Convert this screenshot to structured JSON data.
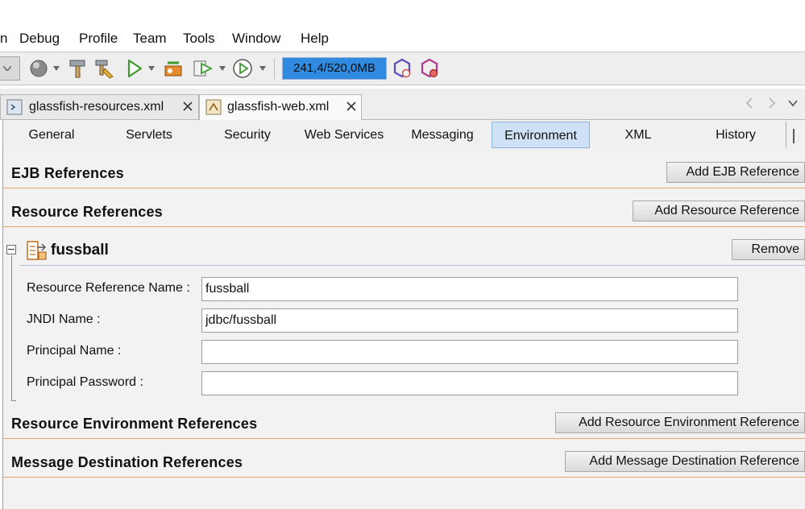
{
  "menu": {
    "items": [
      "n",
      "Debug",
      "Profile",
      "Team",
      "Tools",
      "Window",
      "Help"
    ]
  },
  "toolbar": {
    "memory_label": "241,4/520,0MB",
    "icons": [
      "combo-dropdown",
      "globe-icon",
      "hammer-icon",
      "clean-build-icon",
      "run-icon",
      "debug-icon",
      "profile-icon",
      "performance-icon",
      "gc-icon",
      "memory-reset-icon"
    ]
  },
  "file_tabs": [
    {
      "label": "glassfish-resources.xml",
      "active": false
    },
    {
      "label": "glassfish-web.xml",
      "active": true
    }
  ],
  "editor_tabs": [
    "General",
    "Servlets",
    "Security",
    "Web Services",
    "Messaging",
    "Environment",
    "XML",
    "History"
  ],
  "active_editor_tab": "Environment",
  "sections": {
    "ejb": {
      "title": "EJB References",
      "button": "Add EJB Reference"
    },
    "resource": {
      "title": "Resource References",
      "button": "Add Resource Reference"
    },
    "resource_env": {
      "title": "Resource Environment References",
      "button": "Add Resource Environment Reference"
    },
    "message_dest": {
      "title": "Message Destination References",
      "button": "Add Message Destination Reference"
    }
  },
  "resource_item": {
    "name": "fussball",
    "remove_label": "Remove",
    "fields": [
      {
        "label": "Resource Reference Name :",
        "value": "fussball"
      },
      {
        "label": "JNDI Name :",
        "value": "jdbc/fussball"
      },
      {
        "label": "Principal Name :",
        "value": ""
      },
      {
        "label": "Principal Password :",
        "value": ""
      }
    ]
  },
  "colors": {
    "accent_blue": "#2f8ae0",
    "active_tab": "#cfe2f5",
    "section_line": "#e0a86a"
  }
}
